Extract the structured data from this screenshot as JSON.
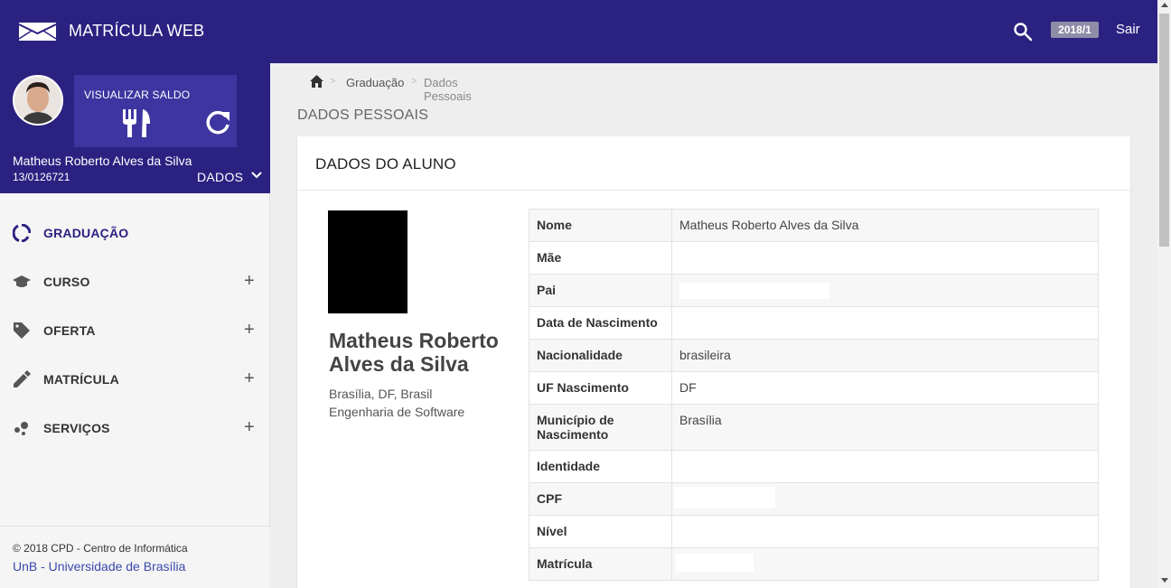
{
  "header": {
    "app_title": "MATRÍCULA WEB",
    "semester": "2018/1",
    "logout_label": "Sair"
  },
  "profile": {
    "saldo_label": "VISUALIZAR SALDO",
    "name": "Matheus Roberto Alves da Silva",
    "id": "13/0126721",
    "dados_label": "DADOS"
  },
  "nav": {
    "items": [
      {
        "label": "GRADUAÇÃO",
        "icon": "circle-progress-icon"
      },
      {
        "label": "CURSO",
        "icon": "graduation-cap-icon"
      },
      {
        "label": "OFERTA",
        "icon": "tag-icon"
      },
      {
        "label": "MATRÍCULA",
        "icon": "pencil-icon"
      },
      {
        "label": "SERVIÇOS",
        "icon": "bubbles-icon"
      }
    ]
  },
  "footer": {
    "copyright": "© 2018 CPD - Centro de Informática",
    "unb": "UnB - Universidade de Brasília"
  },
  "breadcrumb": {
    "level1": "Graduação",
    "current": "Dados Pessoais",
    "sep": ">"
  },
  "page_title": "DADOS PESSOAIS",
  "card": {
    "title": "DADOS DO ALUNO",
    "full_name": "Matheus Roberto Alves da Silva",
    "location": "Brasília, DF, Brasil",
    "course": "Engenharia de Software"
  },
  "table": {
    "rows": [
      {
        "label": "Nome",
        "value": "Matheus Roberto Alves da Silva"
      },
      {
        "label": "Mãe",
        "value": ""
      },
      {
        "label": "Pai",
        "value": ""
      },
      {
        "label": "Data de Nascimento",
        "value": ""
      },
      {
        "label": "Nacionalidade",
        "value": "brasileira"
      },
      {
        "label": "UF Nascimento",
        "value": "DF"
      },
      {
        "label": "Município de Nascimento",
        "value": "Brasília"
      },
      {
        "label": "Identidade",
        "value": ""
      },
      {
        "label": "CPF",
        "value": ""
      },
      {
        "label": "Nível",
        "value": ""
      },
      {
        "label": "Matrícula",
        "value": ""
      }
    ]
  },
  "colors": {
    "primary": "#2b2181",
    "accent_link": "#3949ab"
  }
}
